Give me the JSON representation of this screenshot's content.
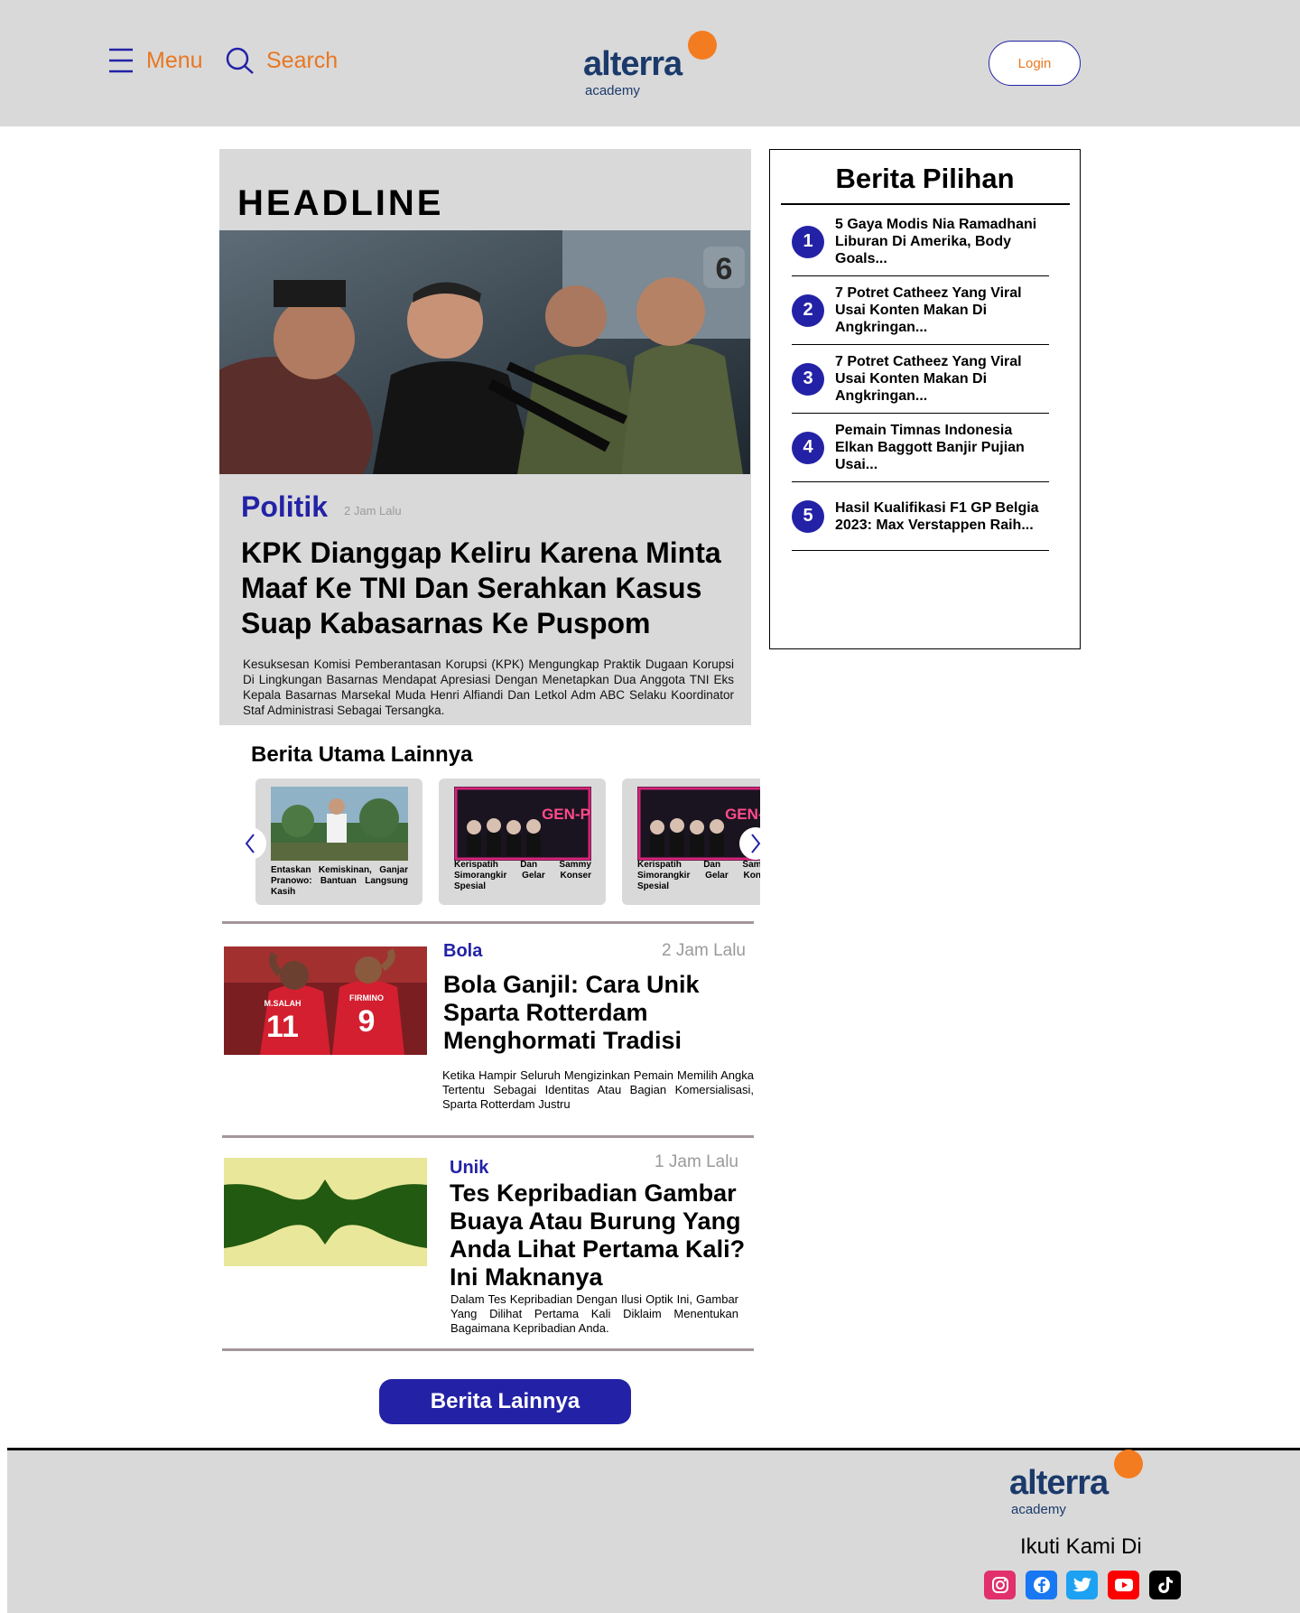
{
  "header": {
    "menu_label": "Menu",
    "search_label": "Search",
    "logo_word": "alterra",
    "logo_sub": "academy",
    "login_label": "Login"
  },
  "headline": {
    "section_title": "HEADLINE",
    "category": "Politik",
    "time": "2 Jam Lalu",
    "title": "KPK Dianggap Keliru Karena Minta Maaf Ke TNI Dan Serahkan Kasus Suap Kabasarnas Ke Puspom",
    "summary": "Kesuksesan Komisi Pemberantasan Korupsi (KPK) Mengungkap Praktik Dugaan Korupsi Di Lingkungan Basarnas Mendapat Apresiasi Dengan Menetapkan Dua Anggota TNI Eks Kepala Basarnas Marsekal Muda Henri Alfiandi Dan Letkol Adm ABC Selaku Koordinator Staf Administrasi Sebagai Tersangka.",
    "image_badge": "6"
  },
  "pilihan": {
    "title": "Berita Pilihan",
    "items": [
      {
        "num": "1",
        "text": "5 Gaya Modis Nia Ramadhani Liburan Di Amerika, Body Goals..."
      },
      {
        "num": "2",
        "text": "7 Potret Catheez Yang Viral Usai Konten Makan Di Angkringan..."
      },
      {
        "num": "3",
        "text": "7 Potret Catheez Yang Viral Usai Konten Makan Di Angkringan..."
      },
      {
        "num": "4",
        "text": "Pemain Timnas Indonesia Elkan Baggott Banjir Pujian Usai..."
      },
      {
        "num": "5",
        "text": "Hasil Kualifikasi F1 GP Belgia 2023: Max Verstappen Raih..."
      }
    ]
  },
  "utama": {
    "title": "Berita Utama Lainnya",
    "cards": [
      {
        "text": "Entaskan Kemiskinan, Ganjar Pranowo: Bantuan Langsung Kasih"
      },
      {
        "text": "Kerispatih Dan Sammy Simorangkir Gelar Konser Spesial",
        "poster": "GEN-P"
      },
      {
        "text": "Kerispatih Dan Sammy Simorangkir Gelar Konser Spesial",
        "poster": "GEN-P"
      }
    ]
  },
  "news": [
    {
      "category": "Bola",
      "time": "2 Jam Lalu",
      "title": "Bola Ganjil: Cara Unik Sparta Rotterdam Menghormati Tradisi",
      "summary": "Ketika Hampir Seluruh Mengizinkan Pemain Memilih Angka Tertentu Sebagai Identitas Atau Bagian Komersialisasi, Sparta Rotterdam Justru",
      "jersey_left_name": "M.SALAH",
      "jersey_left_num": "11",
      "jersey_right_name": "FIRMINO",
      "jersey_right_num": "9"
    },
    {
      "category": "Unik",
      "time": "1 Jam Lalu",
      "title": "Tes Kepribadian Gambar Buaya Atau Burung Yang Anda Lihat Pertama Kali? Ini Maknanya",
      "summary": "Dalam Tes Kepribadian Dengan Ilusi Optik Ini, Gambar Yang Dilihat Pertama Kali Diklaim Menentukan Bagaimana Kepribadian Anda."
    }
  ],
  "more_button": "Berita Lainnya",
  "footer": {
    "logo_word": "alterra",
    "logo_sub": "academy",
    "follow_label": "Ikuti Kami Di",
    "socials": [
      {
        "icon": "instagram-icon",
        "color": "#e1306c"
      },
      {
        "icon": "facebook-icon",
        "color": "#1877f2"
      },
      {
        "icon": "twitter-icon",
        "color": "#1da1f2"
      },
      {
        "icon": "youtube-icon",
        "color": "#ff0000"
      },
      {
        "icon": "tiktok-icon",
        "color": "#000000"
      }
    ]
  },
  "colors": {
    "accent_blue": "#2322a6",
    "accent_orange": "#e87722",
    "panel_gray": "#d9d9d9"
  }
}
